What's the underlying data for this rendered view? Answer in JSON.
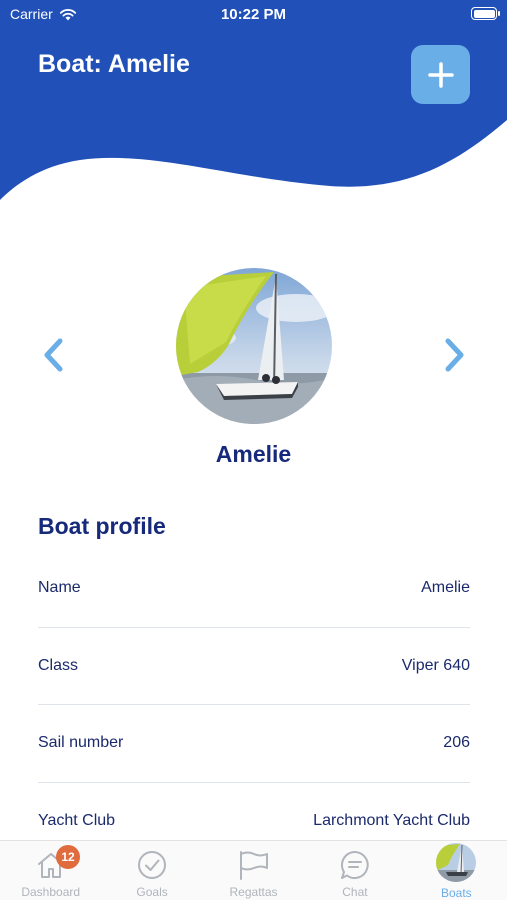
{
  "status_bar": {
    "carrier": "Carrier",
    "time": "10:22 PM"
  },
  "header": {
    "title": "Boat: Amelie",
    "add_icon": "plus-icon"
  },
  "carousel": {
    "boat_name": "Amelie",
    "prev_icon": "chevron-left-icon",
    "next_icon": "chevron-right-icon"
  },
  "profile": {
    "title": "Boat profile",
    "rows": [
      {
        "label": "Name",
        "value": "Amelie"
      },
      {
        "label": "Class",
        "value": "Viper 640"
      },
      {
        "label": "Sail number",
        "value": "206"
      },
      {
        "label": "Yacht Club",
        "value": "Larchmont Yacht Club"
      }
    ]
  },
  "tabs": [
    {
      "label": "Dashboard",
      "icon": "home-icon",
      "badge": "12"
    },
    {
      "label": "Goals",
      "icon": "check-circle-icon"
    },
    {
      "label": "Regattas",
      "icon": "flag-icon"
    },
    {
      "label": "Chat",
      "icon": "chat-bubble-icon"
    },
    {
      "label": "Boats",
      "icon": "boat-avatar",
      "active": true
    }
  ],
  "colors": {
    "header_blue": "#2150b8",
    "accent": "#6aaee8",
    "text_navy": "#1b2a6b",
    "badge": "#e06b3d"
  }
}
